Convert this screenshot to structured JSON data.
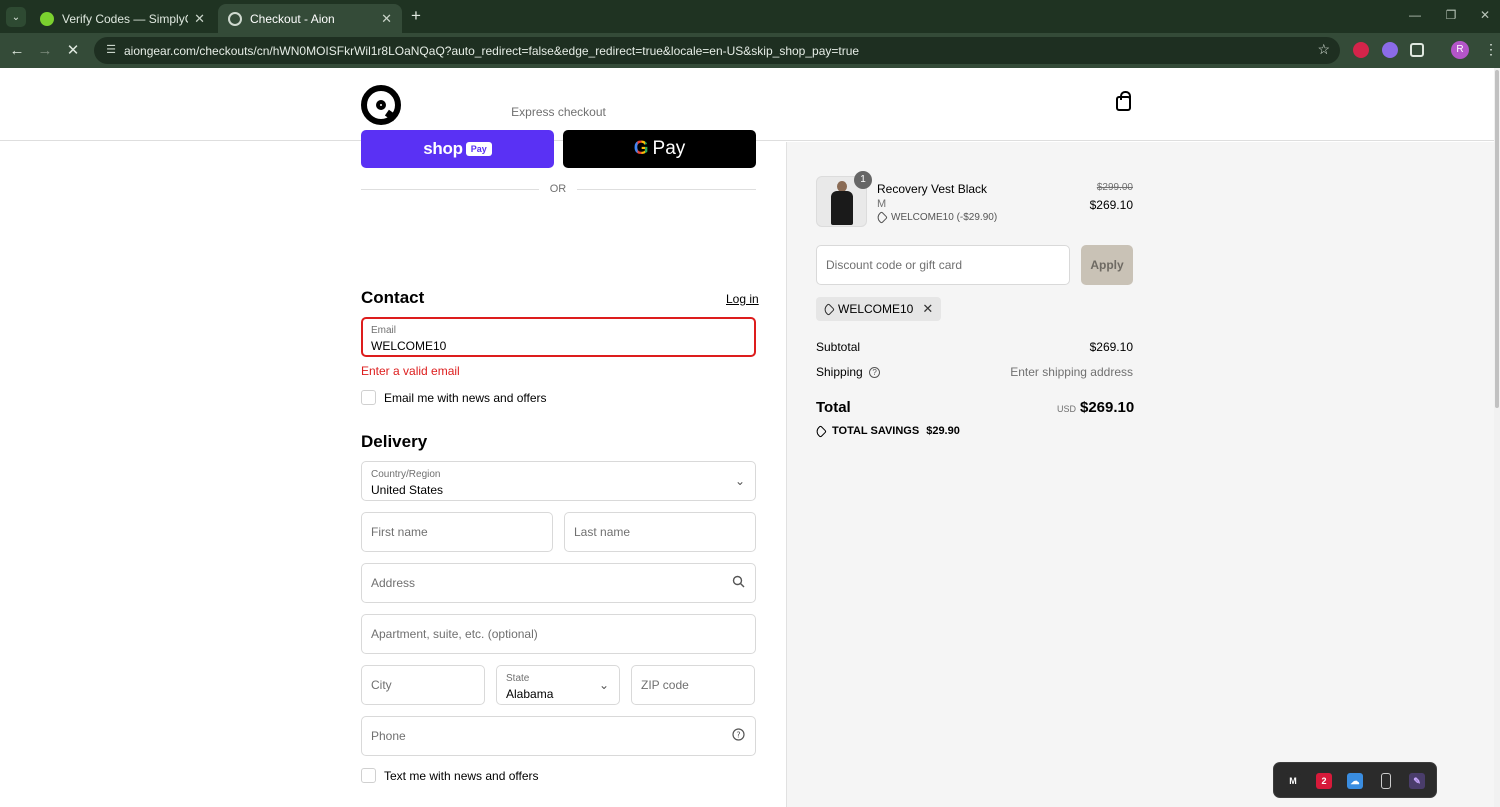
{
  "browser": {
    "tabs": [
      {
        "title": "Verify Codes — SimplyCodes",
        "active": false
      },
      {
        "title": "Checkout - Aion",
        "active": true
      }
    ],
    "url": "aiongear.com/checkouts/cn/hWN0MOISFkrWil1r8LOaNQaQ?auto_redirect=false&edge_redirect=true&locale=en-US&skip_shop_pay=true",
    "profile_initial": "R"
  },
  "express": {
    "label": "Express checkout",
    "shop_word": "shop",
    "shop_pay_badge": "Pay",
    "gpay_g": "G",
    "gpay_text": "Pay",
    "or_text": "OR"
  },
  "contact": {
    "title": "Contact",
    "login_link": "Log in",
    "email_label": "Email",
    "email_value": "WELCOME10",
    "error": "Enter a valid email",
    "newsletter_label": "Email me with news and offers"
  },
  "delivery": {
    "title": "Delivery",
    "country_label": "Country/Region",
    "country_value": "United States",
    "first_name_placeholder": "First name",
    "last_name_placeholder": "Last name",
    "address_placeholder": "Address",
    "apartment_placeholder": "Apartment, suite, etc. (optional)",
    "city_placeholder": "City",
    "state_label": "State",
    "state_value": "Alabama",
    "zip_placeholder": "ZIP code",
    "phone_placeholder": "Phone",
    "sms_label": "Text me with news and offers"
  },
  "order": {
    "item": {
      "quantity": "1",
      "name": "Recovery Vest Black",
      "variant": "M",
      "discount": "WELCOME10 (-$29.90)",
      "price_original": "$299.00",
      "price_final": "$269.10"
    },
    "discount_placeholder": "Discount code or gift card",
    "apply_label": "Apply",
    "applied_code": "WELCOME10",
    "subtotal_label": "Subtotal",
    "subtotal_value": "$269.10",
    "shipping_label": "Shipping",
    "shipping_value": "Enter shipping address",
    "total_label": "Total",
    "currency": "USD",
    "total_value": "$269.10",
    "savings_label": "TOTAL SAVINGS",
    "savings_value": "$29.90"
  },
  "colors": {
    "shop_pay": "#5a31f4",
    "error": "#dd1d1d",
    "apply_disabled": "#c9c2b6"
  }
}
